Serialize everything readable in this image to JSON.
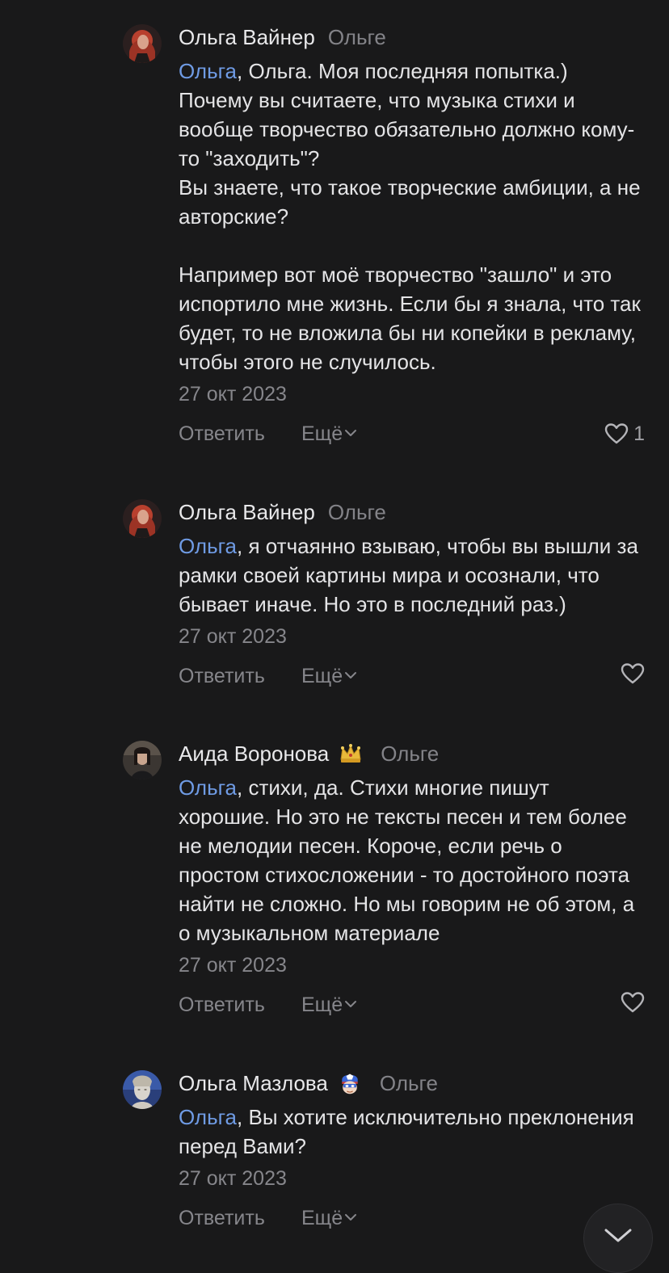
{
  "comments": [
    {
      "author": "Ольга Вайнер",
      "reply_to": "Ольге",
      "mention": "Ольга",
      "text": ", Ольга. Моя последняя попытка.)\nПочему вы считаете, что музыка стихи и вообще творчество обязательно должно кому-то \"заходить\"?\nВы знаете, что такое творческие амбиции, а не авторские?\n\nНапример вот моё творчество \"зашло\" и это испортило мне жизнь. Если бы я знала, что так будет, то не вложила бы ни копейки в рекламу, чтобы этого не случилось.",
      "date": "27 окт 2023",
      "reply_label": "Ответить",
      "more_label": "Ещё",
      "likes": "1"
    },
    {
      "author": "Ольга Вайнер",
      "reply_to": "Ольге",
      "mention": "Ольга",
      "text": ", я отчаянно взываю, чтобы вы вышли за рамки своей картины мира и осознали, что бывает иначе. Но это в последний раз.)",
      "date": "27 окт 2023",
      "reply_label": "Ответить",
      "more_label": "Ещё",
      "likes": ""
    },
    {
      "author": "Аида Воронова",
      "badge": "crown-icon",
      "reply_to": "Ольге",
      "mention": "Ольга",
      "text": ", стихи, да. Стихи многие пишут хорошие. Но это не тексты песен и тем более не мелодии песен. Короче, если речь о простом стихосложении - то достойного поэта найти не сложно. Но мы говорим не об этом, а о музыкальном материале",
      "date": "27 окт 2023",
      "reply_label": "Ответить",
      "more_label": "Ещё",
      "likes": ""
    },
    {
      "author": "Ольга Мазлова",
      "badge": "captain-mask-icon",
      "reply_to": "Ольге",
      "mention": "Ольга",
      "text": ", Вы хотите исключительно преклонения перед Вами?",
      "date": "27 окт 2023",
      "reply_label": "Ответить",
      "more_label": "Ещё",
      "likes": ""
    }
  ],
  "colors": {
    "background": "#19191a",
    "mention": "#6f9be4",
    "secondary": "#86868b"
  }
}
